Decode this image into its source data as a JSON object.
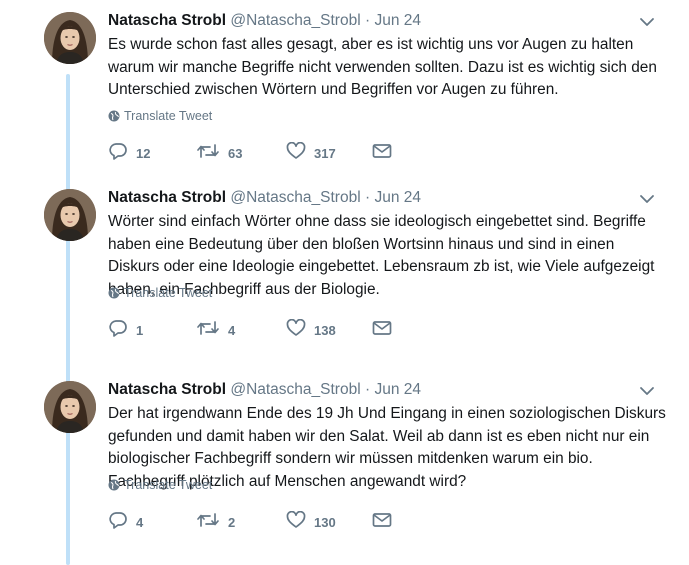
{
  "tweets": [
    {
      "name": "Natascha Strobl",
      "handle": "@Natascha_Strobl",
      "separator": "·",
      "date": "Jun 24",
      "text": "Es wurde schon fast alles gesagt, aber es ist wichtig uns vor Augen zu halten warum wir manche Begriffe nicht verwenden sollten. Dazu ist es wichtig sich den Unterschied zwischen Wörtern und Begriffen vor Augen zu führen.",
      "translate_label": "Translate Tweet",
      "replies": "12",
      "retweets": "63",
      "likes": "317"
    },
    {
      "name": "Natascha Strobl",
      "handle": "@Natascha_Strobl",
      "separator": "·",
      "date": "Jun 24",
      "text": "Wörter sind einfach Wörter ohne dass sie ideologisch eingebettet sind. Begriffe haben eine Bedeutung über den bloßen Wortsinn hinaus und sind in einen Diskurs oder eine Ideologie eingebettet. Lebensraum zb ist, wie Viele aufgezeigt haben, ein Fachbegriff aus der Biologie.",
      "translate_label": "Translate Tweet",
      "replies": "1",
      "retweets": "4",
      "likes": "138"
    },
    {
      "name": "Natascha Strobl",
      "handle": "@Natascha_Strobl",
      "separator": "·",
      "date": "Jun 24",
      "text": "Der hat irgendwann Ende des 19 Jh Und Eingang in einen soziologischen Diskurs gefunden und damit haben wir den Salat. Weil ab dann ist es eben nicht nur ein biologischer Fachbegriff sondern wir müssen mitdenken warum ein bio. Fachbegriff plötzlich auf Menschen angewandt wird?",
      "translate_label": "Translate Tweet",
      "replies": "4",
      "retweets": "2",
      "likes": "130"
    }
  ],
  "icons": {
    "reply": "reply-icon",
    "retweet": "retweet-icon",
    "like": "like-icon",
    "dm": "direct-message-icon",
    "globe": "globe-icon",
    "caret": "chevron-down-icon"
  },
  "colors": {
    "text": "#14171a",
    "secondary": "#657786",
    "thread_line": "#bfe0f8",
    "background": "#ffffff"
  }
}
